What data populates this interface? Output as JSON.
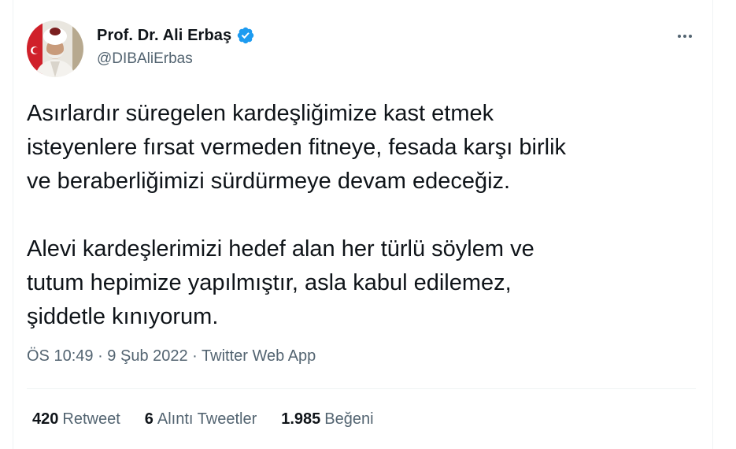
{
  "author": {
    "name": "Prof. Dr. Ali Erbaş",
    "handle": "@DIBAliErbas",
    "verified": true,
    "verified_color": "#1d9bf0"
  },
  "tweet": {
    "paragraphs": [
      "Asırlardır süregelen kardeşliğimize kast etmek\nisteyenlere fırsat vermeden fitneye, fesada karşı birlik\nve beraberliğimizi sürdürmeye devam edeceğiz.",
      "Alevi kardeşlerimizi hedef alan her türlü söylem ve\ntutum hepimize yapılmıştır, asla kabul edilemez,\nşiddetle kınıyorum."
    ]
  },
  "meta": {
    "time": "ÖS 10:49",
    "separator": " · ",
    "date": "9 Şub 2022",
    "source": "Twitter Web App"
  },
  "stats": {
    "retweets_count": "420",
    "retweets_label": "Retweet",
    "quotes_count": "6",
    "quotes_label": "Alıntı Tweetler",
    "likes_count": "1.985",
    "likes_label": "Beğeni"
  },
  "icons": {
    "more": "more-horizontal-icon",
    "verified": "verified-badge-icon"
  }
}
